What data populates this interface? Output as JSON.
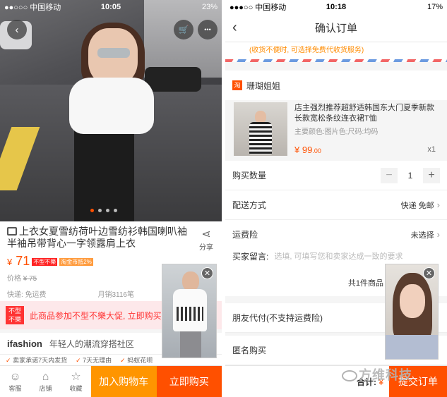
{
  "left": {
    "status": {
      "carrier": "●●○○○ 中国移动",
      "time": "10:05",
      "battery": "23%"
    },
    "buttons": {
      "back": "‹",
      "cart": "🛒",
      "more": "•••"
    },
    "product": {
      "title": "上衣女夏雪纺荷叶边雪纺衫韩国喇叭袖半袖吊带背心一字领露肩上衣",
      "share_label": "分享",
      "price_symbol": "¥",
      "price": "71",
      "tag_not_open": "不型不樂",
      "tag_gold": "淘金币抵2%",
      "original_price_label": "价格",
      "original_price": "¥ 75",
      "shipping": "快递: 免运费",
      "monthly_sales": "月销3116笔"
    },
    "notice": {
      "badge": "不型不樂",
      "text": "此商品参加不型不樂大促, 立即购买"
    },
    "brand": {
      "name": "ifashion",
      "slogan": "年轻人的潮流穿搭社区"
    },
    "promises": [
      "卖家承诺7天内发货",
      "7天无理由",
      "蚂蚁花呗"
    ],
    "bottom": {
      "service": "客服",
      "shop": "店铺",
      "favorite": "收藏",
      "add_cart": "加入购物车",
      "buy_now": "立即购买"
    }
  },
  "right": {
    "status": {
      "carrier": "●●●○○ 中国移动",
      "time": "10:18",
      "battery": "17%"
    },
    "nav": {
      "back": "‹",
      "title": "确认订单"
    },
    "address_note": "(收货不便时, 可选择免费代收货服务)",
    "shop_name": "珊瑚姐姐",
    "item": {
      "name": "店主强烈推荐超舒适韩国东大门夏季新款长款宽松条纹连衣裙T恤",
      "sku": "主要颜色:图片色;尺码:均码",
      "price_symbol": "¥",
      "price": "99",
      "price_cents": ".00",
      "qty": "x1"
    },
    "rows": {
      "quantity_label": "购买数量",
      "quantity_value": "1",
      "delivery_label": "配送方式",
      "delivery_value": "快递 免邮",
      "insurance_label": "运费险",
      "insurance_value": "未选择",
      "message_label": "买家留言:",
      "message_placeholder": "选填, 可填写您和卖家达成一致的要求",
      "total_count": "共1件商品",
      "friend_pay_label": "朋友代付(不支持运费险)",
      "anonymous_label": "匿名购买"
    },
    "bottom": {
      "total_label": "合计:",
      "total_value": "¥",
      "submit": "提交订单"
    }
  },
  "watermark": "方维科技",
  "colors": {
    "accent": "#ff5000",
    "cart": "#ff9500",
    "notice_bg": "#fde8ea"
  }
}
